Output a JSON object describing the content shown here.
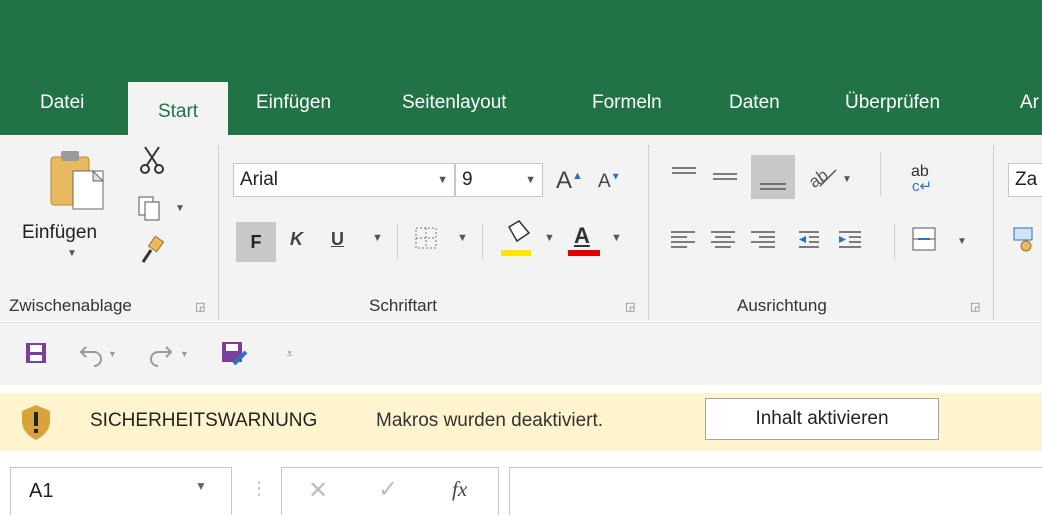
{
  "tabs": [
    "Datei",
    "Start",
    "Einfügen",
    "Seitenlayout",
    "Formeln",
    "Daten",
    "Überprüfen",
    "Ar"
  ],
  "active_tab": "Start",
  "ribbon": {
    "clipboard": {
      "paste_label": "Einfügen",
      "group_label": "Zwischenablage"
    },
    "font": {
      "font_name": "Arial",
      "font_size": "9",
      "bold": "F",
      "italic": "K",
      "underline": "U",
      "increase_size": "A",
      "decrease_size": "A",
      "font_color_letter": "A",
      "group_label": "Schriftart"
    },
    "alignment": {
      "group_label": "Ausrichtung",
      "wrap_label": "ab"
    },
    "number": {
      "format_value": "Za"
    }
  },
  "message_bar": {
    "title": "SICHERHEITSWARNUNG",
    "text": "Makros wurden deaktiviert.",
    "button": "Inhalt aktivieren"
  },
  "formula_bar": {
    "name_box": "A1",
    "fx": "fx"
  },
  "colors": {
    "accent": "#217346",
    "ribbon_bg": "#f3f3f3",
    "warning_bg": "#fff4ce",
    "highlight_yellow": "#ffe600",
    "font_red": "#e00000",
    "qat_purple": "#7b3fa0"
  }
}
